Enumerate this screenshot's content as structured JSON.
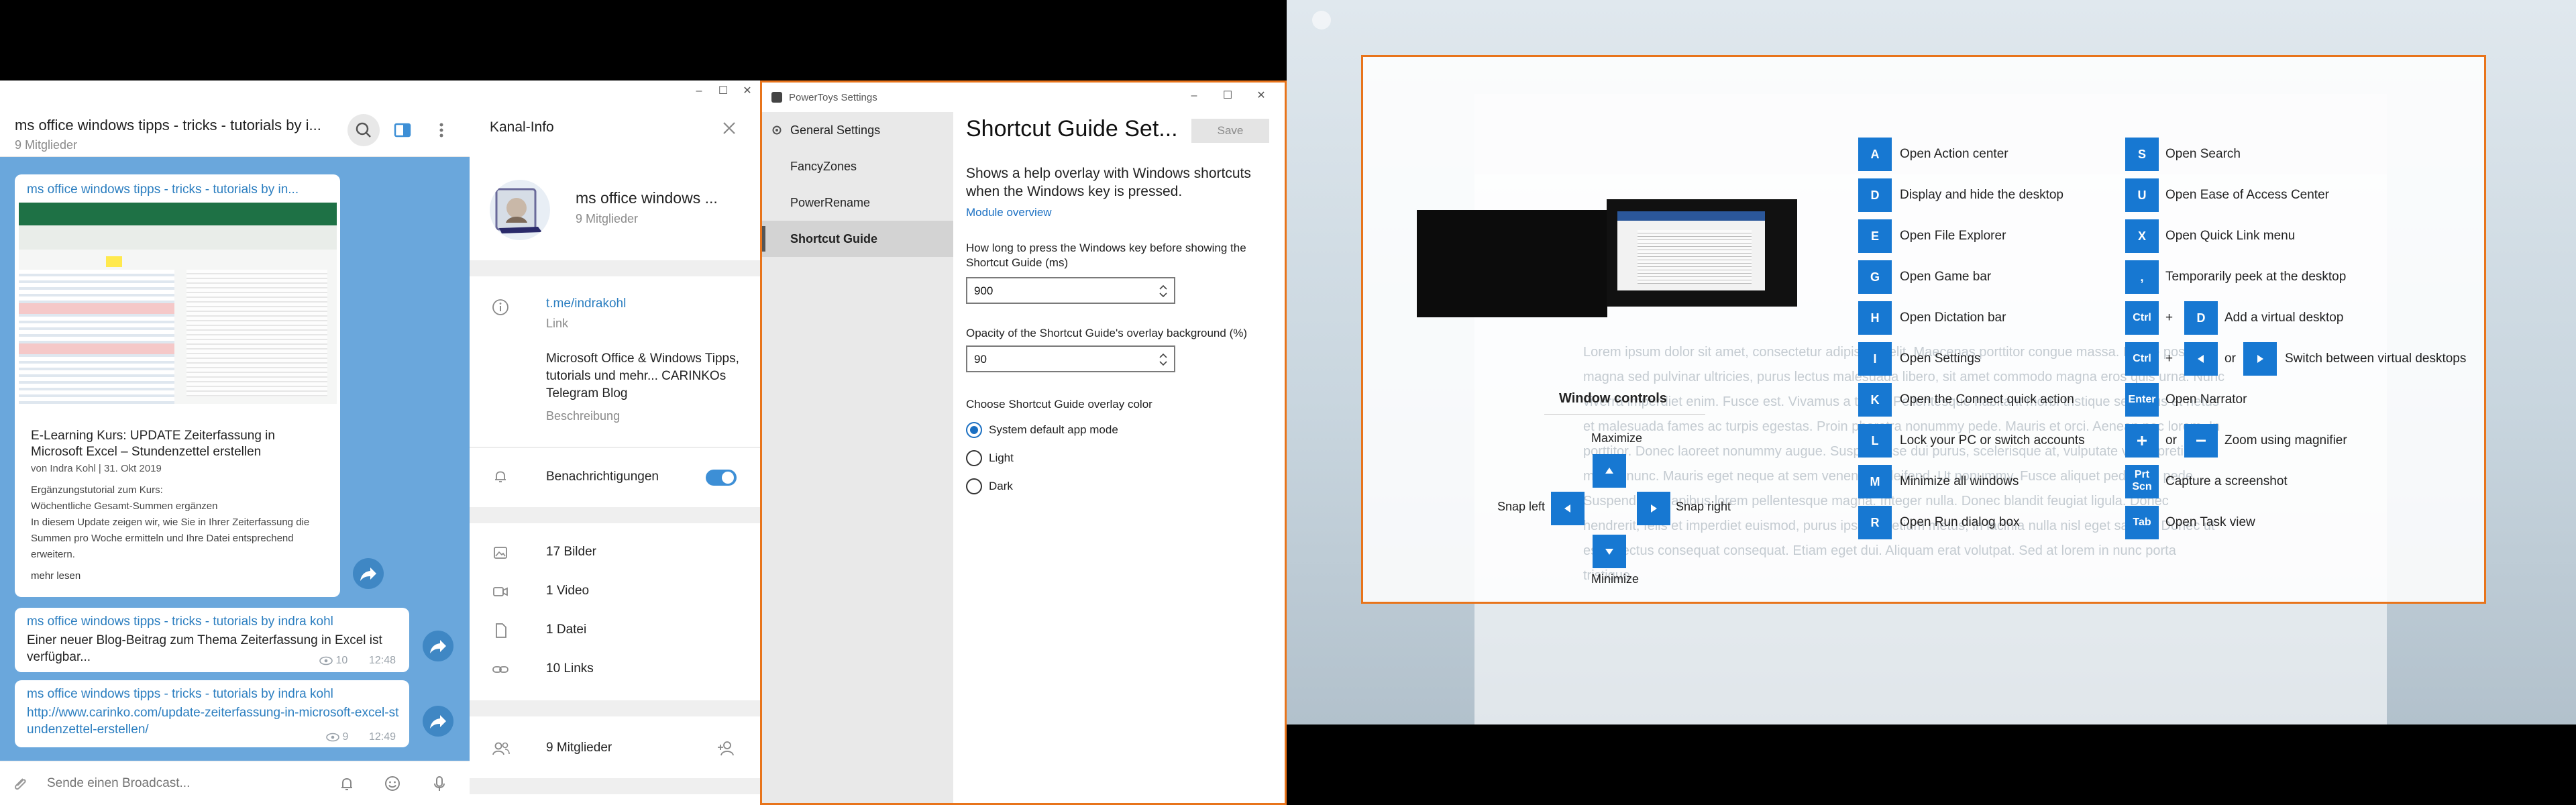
{
  "telegram": {
    "chat_title": "ms office windows tipps - tricks - tutorials by i...",
    "chat_subtitle": "9 Mitglieder",
    "post1": {
      "title": "ms office windows tipps - tricks - tutorials by in...",
      "headline": "E-Learning Kurs: UPDATE Zeiterfassung in Microsoft Excel – Stundenzettel erstellen",
      "byline": "von Indra Kohl | 31. Okt 2019",
      "body": [
        "Ergänzungstutorial zum Kurs:",
        "Wöchentliche Gesamt-Summen ergänzen",
        "In diesem Update zeigen wir, wie Sie in Ihrer Zeiterfassung die",
        "Summen pro Woche ermitteln und Ihre Datei entsprechend",
        "erweitern."
      ],
      "more": "mehr lesen"
    },
    "post2": {
      "title": "ms office windows tipps - tricks - tutorials by indra kohl",
      "text": "Einer neuer Blog-Beitrag zum Thema Zeiterfassung in Excel ist verfügbar...",
      "views": "10",
      "time": "12:48"
    },
    "post3": {
      "title": "ms office windows tipps - tricks - tutorials by indra kohl",
      "link": "http://www.carinko.com/update-zeiterfassung-in-microsoft-excel-stundenzettel-erstellen/",
      "views": "9",
      "time": "12:49"
    },
    "compose_placeholder": "Sende einen Broadcast..."
  },
  "info": {
    "header": "Kanal-Info",
    "channel_name": "ms office windows ...",
    "members": "9 Mitglieder",
    "link": "t.me/indrakohl",
    "link_label": "Link",
    "description": "Microsoft Office & Windows Tipps, tutorials und mehr... CARINKOs Telegram Blog",
    "description_label": "Beschreibung",
    "notifications": "Benachrichtigungen",
    "media": [
      "17 Bilder",
      "1 Video",
      "1 Datei",
      "10 Links"
    ],
    "members_row": "9 Mitglieder"
  },
  "powertoys": {
    "window_title": "PowerToys Settings",
    "nav": [
      "General Settings",
      "FancyZones",
      "PowerRename",
      "Shortcut Guide"
    ],
    "page_title": "Shortcut Guide Set...",
    "save": "Save",
    "description": "Shows a help overlay with Windows shortcuts when the Windows key is pressed.",
    "overview_link": "Module overview",
    "press_label": "How long to press the Windows key before showing the Shortcut Guide (ms)",
    "press_value": "900",
    "opacity_label": "Opacity of the Shortcut Guide's overlay background (%)",
    "opacity_value": "90",
    "color_label": "Choose Shortcut Guide overlay color",
    "color_options": [
      "System default app mode",
      "Light",
      "Dark"
    ]
  },
  "overlay": {
    "window_controls": "Window controls",
    "maximize": "Maximize",
    "minimize": "Minimize",
    "snap_left": "Snap left",
    "snap_right": "Snap right",
    "left_col": [
      {
        "key": "A",
        "label": "Open Action center"
      },
      {
        "key": "D",
        "label": "Display and hide the desktop"
      },
      {
        "key": "E",
        "label": "Open File Explorer"
      },
      {
        "key": "G",
        "label": "Open Game bar"
      },
      {
        "key": "H",
        "label": "Open Dictation bar"
      },
      {
        "key": "I",
        "label": "Open Settings"
      },
      {
        "key": "K",
        "label": "Open the Connect quick action"
      },
      {
        "key": "L",
        "label": "Lock your PC or switch accounts"
      },
      {
        "key": "M",
        "label": "Minimize all windows"
      },
      {
        "key": "R",
        "label": "Open Run dialog box"
      }
    ],
    "right_col": {
      "search": {
        "key": "S",
        "label": "Open Search"
      },
      "ease": {
        "key": "U",
        "label": "Open Ease of Access Center"
      },
      "quick": {
        "key": "X",
        "label": "Open Quick Link menu"
      },
      "peek": {
        "key": ",",
        "label": "Temporarily peek at the desktop"
      },
      "vdesk_ctrl": "Ctrl",
      "plus": "+",
      "vdesk_key": "D",
      "vdesk_label": "Add a virtual desktop",
      "switch_ctrl": "Ctrl",
      "switch_or": "or",
      "switch_label": "Switch between virtual desktops",
      "narrator": {
        "key": "Enter",
        "label": "Open Narrator"
      },
      "magnifier_or": "or",
      "magnifier_label": "Zoom using magnifier",
      "screenshot": {
        "key": "Prt Scn",
        "label": "Capture a screenshot"
      },
      "task": {
        "key": "Tab",
        "label": "Open Task view"
      }
    },
    "lorem": "Lorem ipsum dolor sit amet, consectetur adipiscing elit. Maecenas porttitor congue massa. Fusce posuere, magna sed pulvinar ultricies, purus lectus malesuada libero, sit amet commodo magna eros quis urna. Nunc viverra imperdiet enim. Fusce est. Vivamus a tellus. Pellentesque habitant morbi tristique senectus et netus et malesuada fames ac turpis egestas. Proin pharetra nonummy pede. Mauris et orci. Aenean nec lorem. In porttitor. Donec laoreet nonummy augue. Suspendisse dui purus, scelerisque at, vulputate vitae, pretium mattis, nunc. Mauris eget neque at sem venenatis eleifend. Ut nonummy. Fusce aliquet pede non pede. Suspendisse dapibus lorem pellentesque magna. Integer nulla. Donec blandit feugiat ligula. Donec hendrerit, felis et imperdiet euismod, purus ipsum pretium metus, in lacinia nulla nisl eget sapien. Donec ut est in lectus consequat consequat. Etiam eget dui. Aliquam erat volutpat. Sed at lorem in nunc porta tristique."
  }
}
